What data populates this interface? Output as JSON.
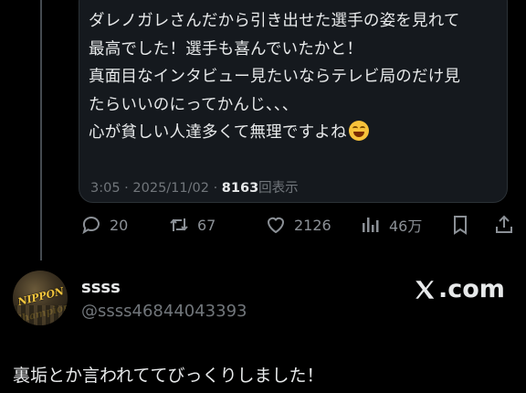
{
  "quoted_tweet": {
    "lines": [
      "ダレノガレさんだから引き出せた選手の姿を見れて",
      "最高でした！選手も喜んでいたかと！",
      "真面目なインタビュー見たいならテレビ局のだけ見",
      "たらいいのにってかんじ、、、",
      "心が貧しい人達多くて無理ですよね"
    ],
    "emoji": "face-with-tears-of-joy-emoji",
    "time": "3:05",
    "separator": "·",
    "date": "2025/11/02",
    "views_count": "8163",
    "views_label": "回表示"
  },
  "actions": {
    "reply_count": "20",
    "retweet_count": "67",
    "like_count": "2126",
    "view_count": "46万",
    "icons": [
      "reply-icon",
      "retweet-icon",
      "like-icon",
      "views-icon",
      "bookmark-icon",
      "share-icon"
    ]
  },
  "reply": {
    "display_name": "ssss",
    "handle": "@ssss46844043393",
    "avatar_text": "NIPPON Champions 2025",
    "watermark": "X.com",
    "text": "裏垢とか言われててびっくりしました！"
  },
  "colors": {
    "background": "#000000",
    "text": "#e7e9ea",
    "secondary": "#71767b",
    "card_bg": "#15191e",
    "avatar_accent": "#f2c53d"
  }
}
